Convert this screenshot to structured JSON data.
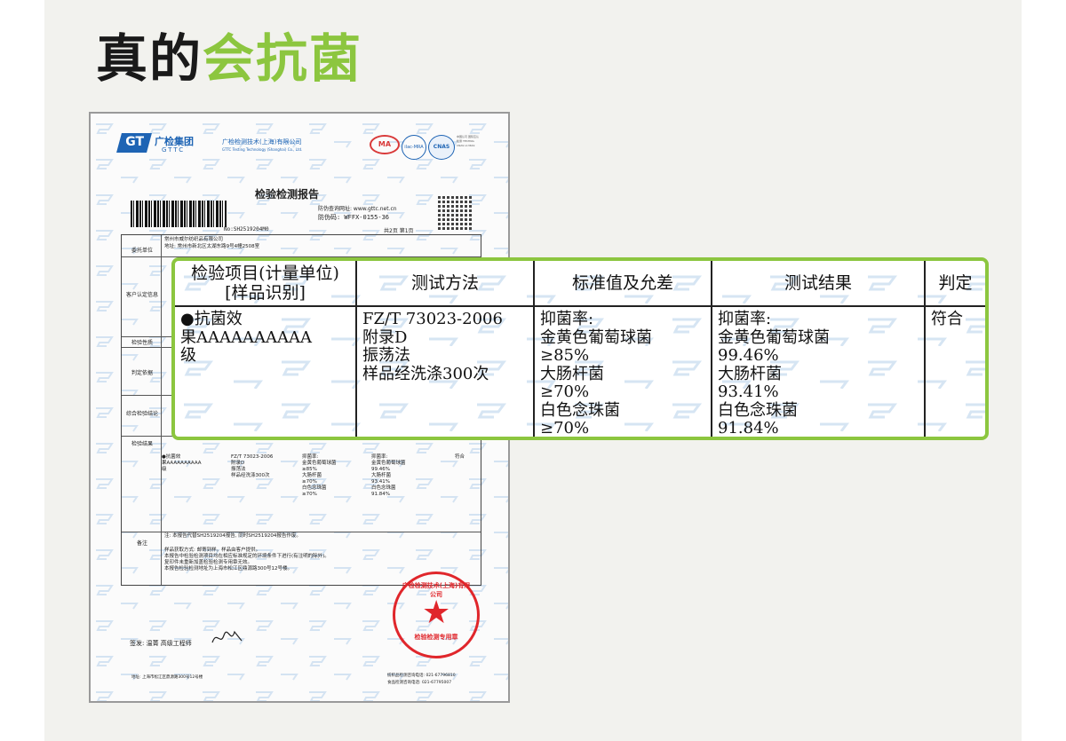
{
  "headline": {
    "part1": "真的",
    "part2": "会抗菌"
  },
  "colors": {
    "accent": "#8cc63f",
    "brand_blue": "#1e64b4",
    "seal_red": "#e0262b"
  },
  "report": {
    "group_name": "广检集团",
    "group_en": "GTTC",
    "company_cn": "广检检测技术(上海)有限公司",
    "company_en": "GTTC Testing Technology (Shanghai) Co., Ltd.",
    "ma_mark": "MA",
    "ilac_mark": "ilac-MRA",
    "cnas_mark": "CNAS",
    "cnas_text": "中国认可 国际互认 检测 TESTING CNAS L13619",
    "title": "检验检测报告",
    "anti_fake_url": "防伪查询网址: www.gttc.net.cn",
    "anti_fake_code": "防伪码: WFFX-0155-36",
    "report_no": "No:SH2519204M0",
    "page_info": "共2页 第1页",
    "client_label": "委托单位",
    "client_name": "常州市威尔纺织品有限公司",
    "client_addr": "地址: 常州市新北区太湖东路9号4幢2508室",
    "confirm_label": "客户认定信息",
    "nature_label": "检验性质",
    "basis_label": "判定依据",
    "conclusion_label": "综合检验结论",
    "results_label": "检验结果",
    "remarks_label": "备注",
    "remark_line1": "注: 本报告代替SH2519204报告, 同时SH2519204报告作废。",
    "remark_line2": "样品获取方式: 邮寄到样。样品由客户提供。",
    "remark_line3": "本报告中检验检测项目均在相应标准规定的环境条件下进行(有注明的除外)。",
    "remark_line4": "复印件未重新加盖检验检测专用章无效。",
    "remark_line5": "本报告检验检测地址为上海市松江区鼎源路300号12号楼。",
    "signer": "签发: 温菁 高级工程师",
    "address_footer": "地址: 上海市松江区鼎源路300号12号楼",
    "phone1": "纺织品检测咨询电话: 021-67796810",
    "phone2": "食品检测咨询电话: 021-67795007",
    "seal_ring": "广检检测技术(上海)有限公司",
    "seal_use": "检验检测专用章"
  },
  "results_table": {
    "headers": [
      "检验项目(计量单位)\n[样品识别]",
      "测试方法",
      "标准值及允差",
      "测试结果",
      "判定"
    ],
    "row": {
      "item": "●抗菌效\n果AAAAAAAAAA\n级",
      "method": "FZ/T 73023-2006\n附录D\n振荡法\n样品经洗涤300次",
      "standard": "抑菌率:\n金黄色葡萄球菌\n≥85%\n大肠杆菌\n≥70%\n白色念珠菌\n≥70%",
      "result": "抑菌率:\n金黄色葡萄球菌\n99.46%\n大肠杆菌\n93.41%\n白色念珠菌\n91.84%",
      "verdict": "符合"
    }
  }
}
